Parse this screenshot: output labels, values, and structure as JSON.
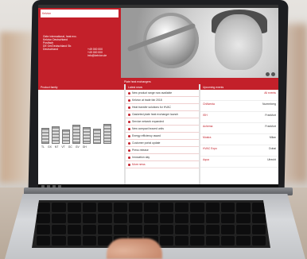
{
  "site": {
    "contact_title": "Kelvion",
    "contact_lines": [
      "Gebr international, heat exc.",
      "Kelvion Deutschland",
      "Postfach",
      "DE Ort/Deutschland Str.",
      "Deutschland"
    ],
    "phones": [
      "+49 000 000",
      "+49 000 000",
      "info@kelvion.de"
    ],
    "hero_title": "Plate heat exchangers"
  },
  "products": {
    "heading": "Product family",
    "labels": [
      "TL",
      "GX",
      "NT",
      "VT",
      "GC",
      "GV",
      "GH"
    ],
    "nav": [
      "Home",
      "Products",
      "Service",
      "Contact"
    ]
  },
  "news": {
    "heading": "Latest news",
    "items": [
      "New product range now available",
      "Kelvion at trade fair 2018",
      "Heat transfer solutions for HVAC",
      "Gasketed plate heat exchanger launch",
      "Service network expanded",
      "New compact brazed units",
      "Energy efficiency award",
      "Customer portal update",
      "Press release",
      "Innovation day",
      "More news"
    ]
  },
  "events": {
    "heading": "Upcoming events",
    "more": "All events",
    "rows": [
      [
        "Chillventa",
        "Nuremberg"
      ],
      [
        "ISH",
        "Frankfurt"
      ],
      [
        "Achema",
        "Frankfurt"
      ],
      [
        "Mostra",
        "Milan"
      ],
      [
        "HVAC Expo",
        "Dubai"
      ],
      [
        "Aqua",
        "Utrecht"
      ]
    ]
  },
  "colors": {
    "brand": "#c3202a"
  }
}
